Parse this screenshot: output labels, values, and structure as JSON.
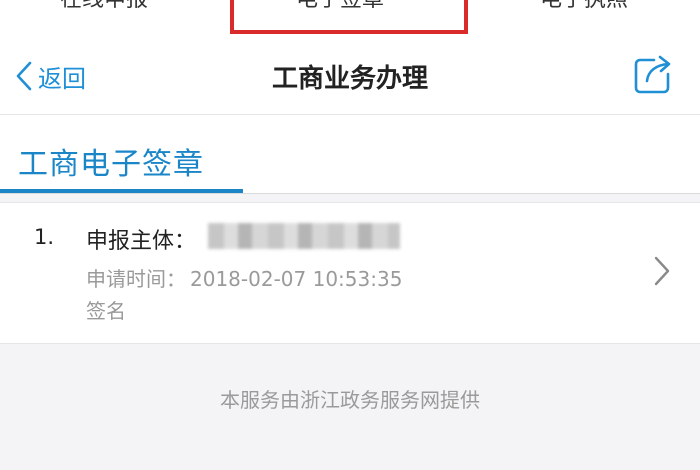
{
  "top_tabs": [
    "在线申报",
    "电子签章",
    "电子执照"
  ],
  "nav": {
    "back_label": "返回",
    "title": "工商业务办理"
  },
  "section": {
    "label": "工商电子签章"
  },
  "record": {
    "index": "1.",
    "subject_label": "申报主体：",
    "time_label": "申请时间：",
    "time_value": "2018-02-07 10:53:35",
    "sign_label": "签名"
  },
  "footer": "本服务由浙江政务服务网提供",
  "colors": {
    "accent": "#1a86c8",
    "highlight": "#d92b2b"
  },
  "icons": {
    "back": "chevron-left-icon",
    "share": "share-icon",
    "row": "chevron-right-icon"
  }
}
